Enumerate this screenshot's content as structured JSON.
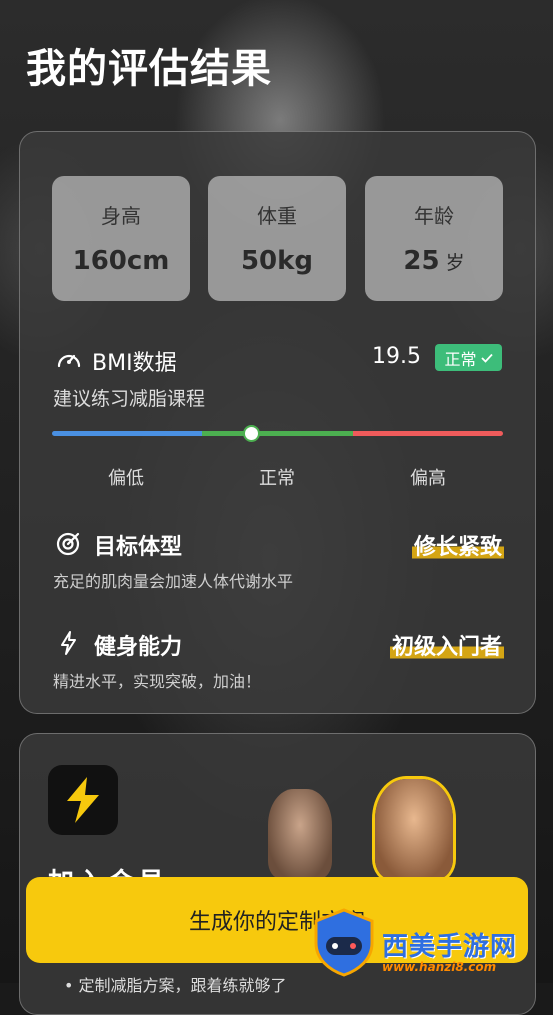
{
  "header": {
    "title": "我的评估结果"
  },
  "stats": [
    {
      "label": "身高",
      "value": "160cm",
      "unit": ""
    },
    {
      "label": "体重",
      "value": "50kg",
      "unit": ""
    },
    {
      "label": "年龄",
      "value": "25",
      "unit": "岁"
    }
  ],
  "bmi": {
    "title": "BMI数据",
    "value": "19.5",
    "status": "正常",
    "subtitle": "建议练习减脂课程",
    "scale_labels": [
      "偏低",
      "正常",
      "偏高"
    ],
    "colors": {
      "low": "#4a90e2",
      "normal": "#4caf50",
      "high": "#ef5b5b"
    }
  },
  "goal": {
    "title": "目标体型",
    "value": "修长紧致",
    "subtitle": "充足的肌肉量会加速人体代谢水平"
  },
  "fitness": {
    "title": "健身能力",
    "value": "初级入门者",
    "subtitle": "精进水平，实现突破，加油！"
  },
  "membership": {
    "title": "加入会员",
    "feature_1": "• 定制减脂方案，跟着练就够了"
  },
  "cta": {
    "label": "生成你的定制方案"
  },
  "watermark": {
    "text": "西美手游网",
    "url": "www.hanzi8.com"
  },
  "theme": {
    "accent": "#f7c90d",
    "badge": "#3dbd7a",
    "highlight": "#d4a514"
  }
}
